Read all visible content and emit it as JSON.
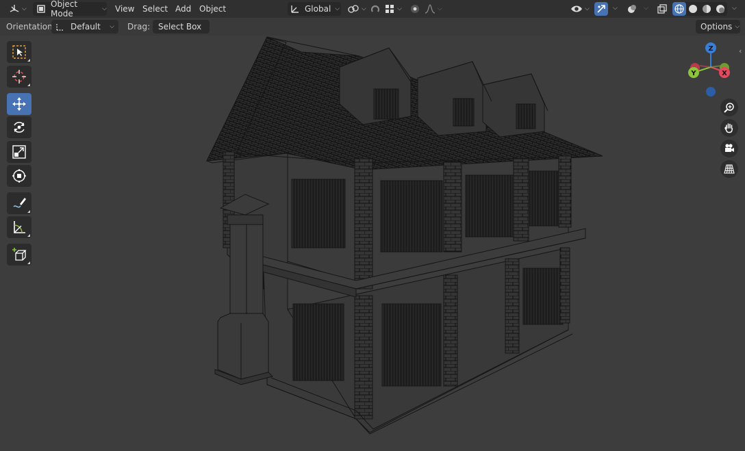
{
  "header": {
    "editor_type_icon": "editor-type-3d-viewport-icon",
    "mode_label": "Object Mode",
    "menus": [
      "View",
      "Select",
      "Add",
      "Object"
    ],
    "transform_orientation": "Global",
    "pivot_icon": "pivot-point-icon",
    "snap_icon": "snap-magnet-icon",
    "snap_target_icon": "snap-increment-icon",
    "proportional_icon": "proportional-edit-icon",
    "falloff_icon": "falloff-curve-icon",
    "visibility_icon": "eye-visibility-icon",
    "gizmo_icon": "gizmo-toggle-icon",
    "overlay_icon": "overlays-icon",
    "xray_icon": "xray-toggle-icon",
    "shading_modes": [
      "wireframe",
      "solid",
      "material-preview",
      "rendered"
    ],
    "active_shading": "wireframe"
  },
  "toolrow": {
    "orientation_label": "Orientation:",
    "orientation_value": "Default",
    "drag_label": "Drag:",
    "drag_value": "Select Box",
    "options_label": "Options"
  },
  "toolbar": {
    "tools": [
      {
        "name": "select-box",
        "icon": "select-box-icon",
        "active": false
      },
      {
        "name": "cursor",
        "icon": "cursor-icon",
        "active": false
      },
      {
        "name": "move",
        "icon": "move-icon",
        "active": true
      },
      {
        "name": "rotate",
        "icon": "rotate-icon",
        "active": false
      },
      {
        "name": "scale",
        "icon": "scale-icon",
        "active": false
      },
      {
        "name": "transform",
        "icon": "transform-icon",
        "active": false
      },
      {
        "name": "annotate",
        "icon": "annotate-icon",
        "active": false
      },
      {
        "name": "measure",
        "icon": "measure-icon",
        "active": false
      },
      {
        "name": "add-cube",
        "icon": "add-cube-icon",
        "active": false
      }
    ]
  },
  "navigation_gizmo": {
    "axes": [
      "Z",
      "X",
      "Y"
    ],
    "colors": {
      "x": "#e34a5f",
      "y": "#8cc43b",
      "z": "#3a7fd6"
    }
  },
  "nav_buttons": [
    "zoom-icon",
    "pan-hand-icon",
    "camera-view-icon",
    "perspective-grid-icon"
  ],
  "colors": {
    "accent": "#4772b3",
    "header_bg": "#303030",
    "viewport_bg": "#3d3d3d"
  }
}
